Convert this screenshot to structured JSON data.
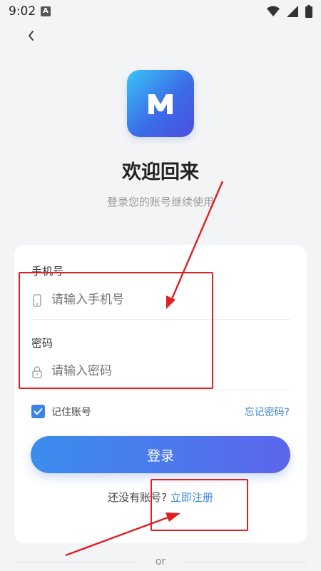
{
  "status_bar": {
    "time": "9:02",
    "badge": "A"
  },
  "header": {
    "title": "欢迎回来",
    "subtitle": "登录您的账号继续使用"
  },
  "logo": {
    "letter": "M"
  },
  "form": {
    "phone_label": "手机号",
    "phone_placeholder": "请输入手机号",
    "password_label": "密码",
    "password_placeholder": "请输入密码",
    "remember_label": "记住账号",
    "remember_checked": true,
    "forgot_label": "忘记密码?",
    "login_button": "登录"
  },
  "register": {
    "prompt": "还没有账号?",
    "link": "立即注册"
  },
  "footer": {
    "or_text": "or"
  },
  "colors": {
    "accent": "#3a86d9",
    "annotation": "#e02020"
  }
}
